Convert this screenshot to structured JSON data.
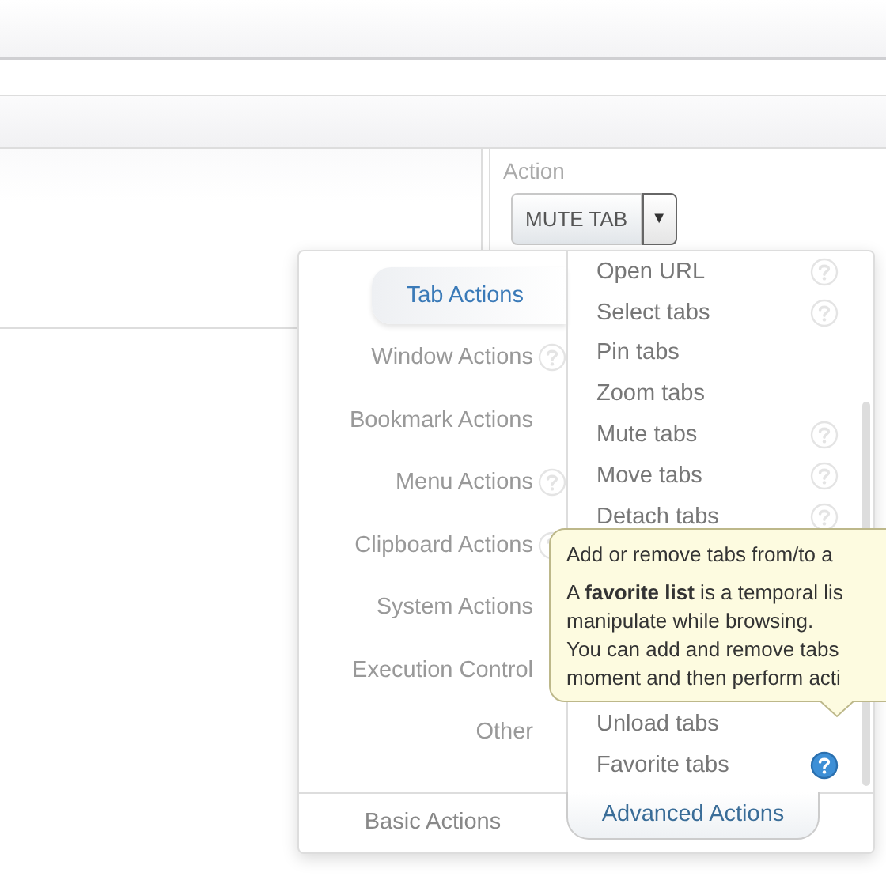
{
  "action_panel": {
    "label": "Action",
    "value": "MUTE TAB",
    "dropdown_symbol": "▼"
  },
  "popup": {
    "categories": [
      {
        "label": "Tab Actions",
        "selected": true,
        "help": false
      },
      {
        "label": "Window Actions",
        "selected": false,
        "help": true
      },
      {
        "label": "Bookmark Actions",
        "selected": false,
        "help": false
      },
      {
        "label": "Menu Actions",
        "selected": false,
        "help": true
      },
      {
        "label": "Clipboard Actions",
        "selected": false,
        "help": true
      },
      {
        "label": "System Actions",
        "selected": false,
        "help": false
      },
      {
        "label": "Execution Control",
        "selected": false,
        "help": false
      },
      {
        "label": "Other",
        "selected": false,
        "help": false
      }
    ],
    "actions": [
      {
        "label": "Open URL",
        "help": true,
        "help_active": false
      },
      {
        "label": "Select tabs",
        "help": true,
        "help_active": false
      },
      {
        "label": "Pin tabs",
        "help": false,
        "help_active": false
      },
      {
        "label": "Zoom tabs",
        "help": false,
        "help_active": false
      },
      {
        "label": "Mute tabs",
        "help": true,
        "help_active": false
      },
      {
        "label": "Move tabs",
        "help": true,
        "help_active": false
      },
      {
        "label": "Detach tabs",
        "help": true,
        "help_active": false
      }
    ],
    "actions_bottom": [
      {
        "label": "Unload tabs",
        "help": false,
        "help_active": false
      },
      {
        "label": "Favorite tabs",
        "help": true,
        "help_active": true
      }
    ],
    "bottom_tabs": [
      {
        "label": "Basic Actions",
        "selected": false
      },
      {
        "label": "Advanced Actions",
        "selected": true
      }
    ]
  },
  "tooltip": {
    "title": "Add or remove tabs from/to a",
    "lines": [
      "A **favorite list** is a temporal lis",
      "manipulate while browsing.",
      "You can add and remove tabs",
      "moment and then perform acti"
    ]
  }
}
